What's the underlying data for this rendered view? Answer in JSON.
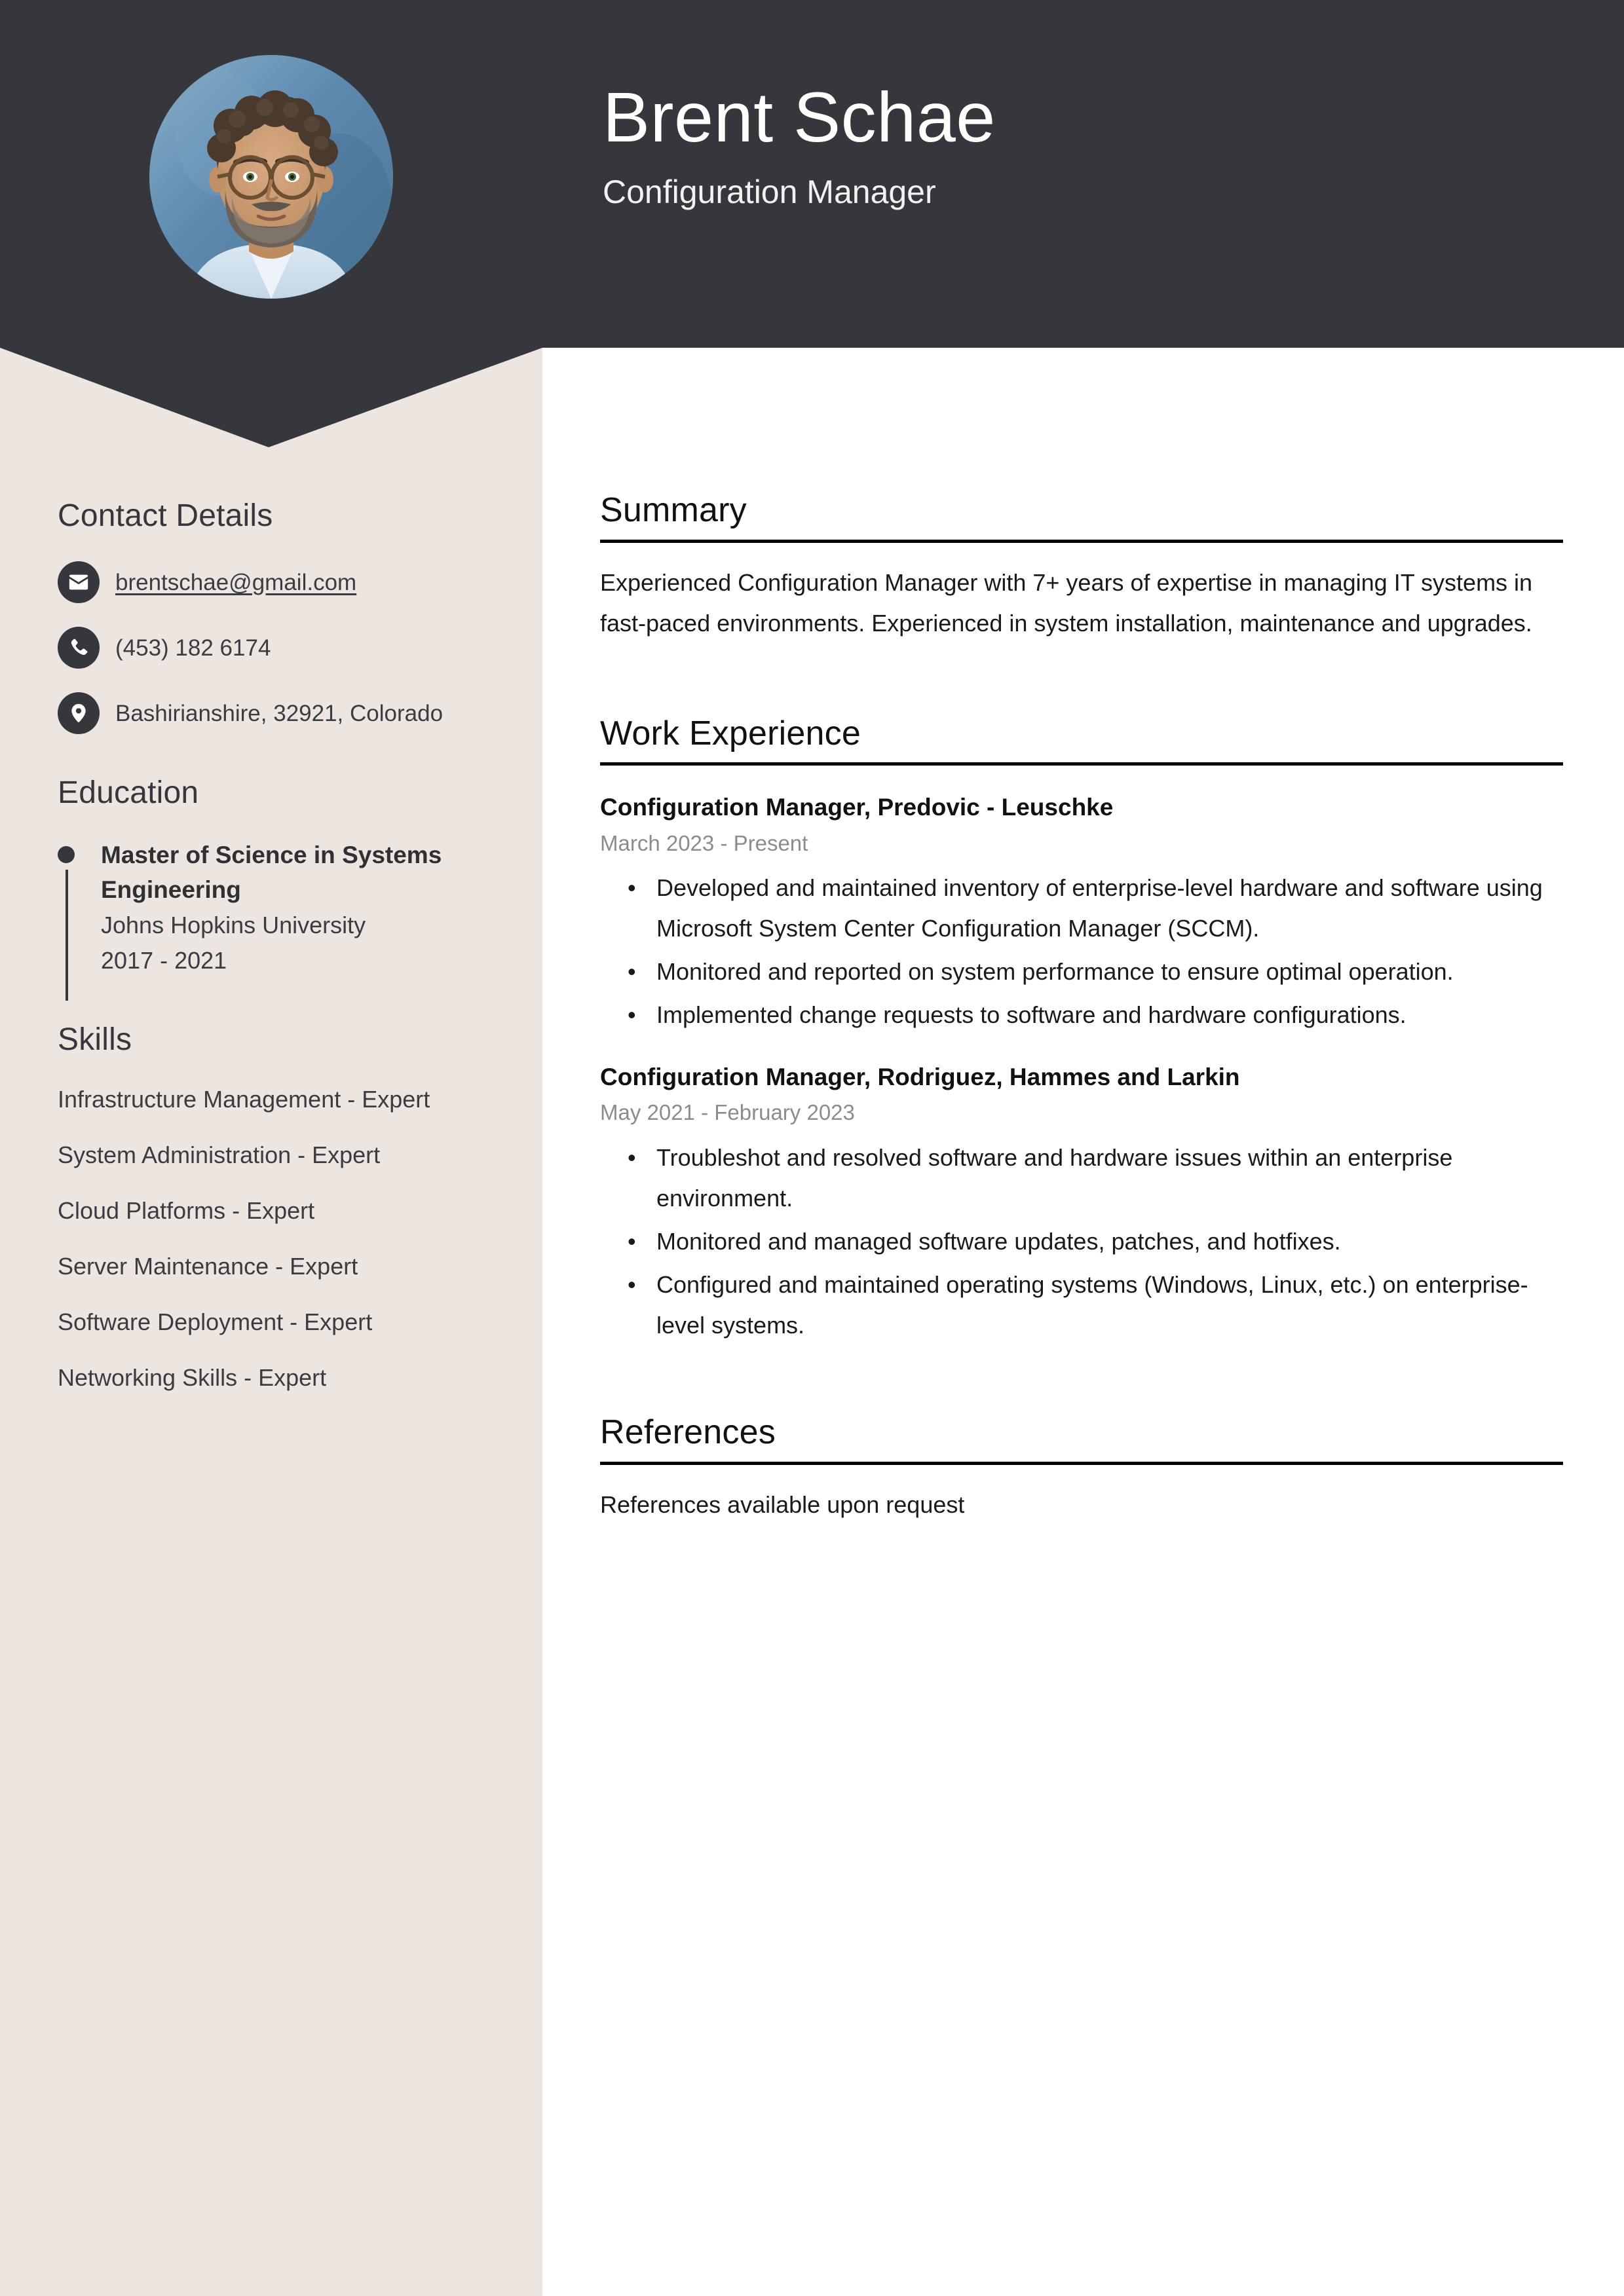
{
  "header": {
    "name": "Brent Schae",
    "job_title": "Configuration Manager",
    "avatar_alt": "profile-photo",
    "background_color": "#35373C"
  },
  "sidebar": {
    "background_color": "#EDE5E0",
    "contact": {
      "heading": "Contact Details",
      "items": [
        {
          "icon": "envelope-icon",
          "value": "brentschae@gmail.com",
          "type": "email"
        },
        {
          "icon": "phone-icon",
          "value": "(453) 182 6174",
          "type": "phone"
        },
        {
          "icon": "location-pin-icon",
          "value": "Bashirianshire, 32921, Colorado",
          "type": "address"
        }
      ]
    },
    "education": {
      "heading": "Education",
      "entries": [
        {
          "degree": "Master of Science in Systems Engineering",
          "school": "Johns Hopkins University",
          "dates": "2017 - 2021"
        }
      ]
    },
    "skills": {
      "heading": "Skills",
      "items": [
        "Infrastructure Management - Expert",
        "System Administration - Expert",
        "Cloud Platforms - Expert",
        "Server Maintenance - Expert",
        "Software Deployment - Expert",
        "Networking Skills - Expert"
      ]
    }
  },
  "main": {
    "summary": {
      "heading": "Summary",
      "text": "Experienced Configuration Manager with 7+ years of expertise in managing IT systems in fast-paced environments. Experienced in system installation, maintenance and upgrades."
    },
    "work_experience": {
      "heading": "Work Experience",
      "jobs": [
        {
          "title": "Configuration Manager, Predovic - Leuschke",
          "dates": "March 2023 - Present",
          "bullets": [
            "Developed and maintained inventory of enterprise-level hardware and software using Microsoft System Center Configuration Manager (SCCM).",
            "Monitored and reported on system performance to ensure optimal operation.",
            "Implemented change requests to software and hardware configurations."
          ]
        },
        {
          "title": "Configuration Manager, Rodriguez, Hammes and Larkin",
          "dates": "May 2021 - February 2023",
          "bullets": [
            "Troubleshot and resolved software and hardware issues within an enterprise environment.",
            "Monitored and managed software updates, patches, and hotfixes.",
            "Configured and maintained operating systems (Windows, Linux, etc.) on enterprise-level systems."
          ]
        }
      ]
    },
    "references": {
      "heading": "References",
      "text": "References available upon request"
    }
  }
}
